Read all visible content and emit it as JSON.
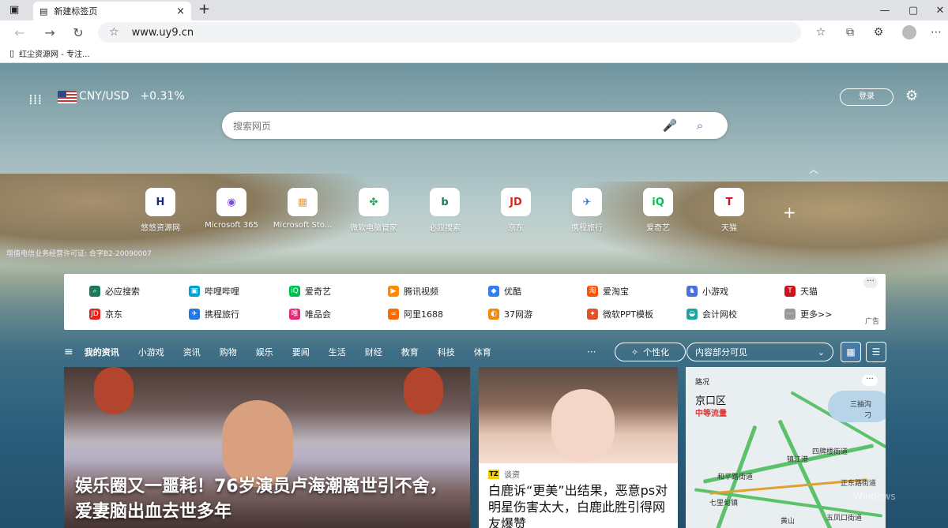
{
  "browser": {
    "tab": {
      "title": "新建标签页",
      "close": "×"
    },
    "new_tab": "+",
    "window": {
      "min": "—",
      "max": "▢",
      "close": "✕"
    },
    "address": {
      "url": "www.uy9.cn"
    },
    "bookmark": {
      "label": "红尘资源网 - 专注..."
    }
  },
  "ntp": {
    "currency": {
      "label": "CNY/USD",
      "change": "+0.31%"
    },
    "login": "登录",
    "search_placeholder": "搜索网页",
    "license": "增值电信业务经营许可证: 合字B2-20090007",
    "tiles": [
      {
        "label": "悠悠资源网",
        "glyph": "H",
        "color": "#1a2a7a"
      },
      {
        "label": "Microsoft 365",
        "glyph": "◉",
        "color": "#7a4fd6"
      },
      {
        "label": "Microsoft Sto...",
        "glyph": "▦",
        "color": "#e8a13a"
      },
      {
        "label": "微软电脑管家",
        "glyph": "✤",
        "color": "#2aa25c"
      },
      {
        "label": "必应搜索",
        "glyph": "b",
        "color": "#1b7a5a"
      },
      {
        "label": "京东",
        "glyph": "JD",
        "color": "#e1251b"
      },
      {
        "label": "携程旅行",
        "glyph": "✈",
        "color": "#2577e3"
      },
      {
        "label": "爱奇艺",
        "glyph": "iQ",
        "color": "#00c14f"
      },
      {
        "label": "天猫",
        "glyph": "T",
        "color": "#c9151e"
      }
    ],
    "links": [
      {
        "label": "必应搜索",
        "color": "#1b7a5a",
        "glyph": "⌕"
      },
      {
        "label": "哔哩哔哩",
        "color": "#00a1d6",
        "glyph": "▣"
      },
      {
        "label": "爱奇艺",
        "color": "#00c14f",
        "glyph": "iQ"
      },
      {
        "label": "腾讯视频",
        "color": "#ff8a00",
        "glyph": "▶"
      },
      {
        "label": "优酷",
        "color": "#2f7ef5",
        "glyph": "◆"
      },
      {
        "label": "爱淘宝",
        "color": "#ff5000",
        "glyph": "淘"
      },
      {
        "label": "小游戏",
        "color": "#4c6fe0",
        "glyph": "♞"
      },
      {
        "label": "天猫",
        "color": "#c9151e",
        "glyph": "T"
      },
      {
        "label": "京东",
        "color": "#e1251b",
        "glyph": "JD"
      },
      {
        "label": "携程旅行",
        "color": "#2577e3",
        "glyph": "✈"
      },
      {
        "label": "唯品会",
        "color": "#e6287b",
        "glyph": "唯"
      },
      {
        "label": "阿里1688",
        "color": "#ff6a00",
        "glyph": "∞"
      },
      {
        "label": "37网游",
        "color": "#f28a0c",
        "glyph": "◐"
      },
      {
        "label": "微软PPT模板",
        "color": "#e0532a",
        "glyph": "✦"
      },
      {
        "label": "会计网校",
        "color": "#18a6a0",
        "glyph": "◒"
      },
      {
        "label": "更多>>",
        "color": "#999999",
        "glyph": "⋯"
      }
    ],
    "ad_label": "广告",
    "more_dots": "···",
    "news_nav": [
      "我的资讯",
      "小游戏",
      "资讯",
      "购物",
      "娱乐",
      "要闻",
      "生活",
      "财经",
      "教育",
      "科技",
      "体育"
    ],
    "news_more": "···",
    "personalize": "个性化",
    "visibility": "内容部分可见",
    "cards": {
      "main_title": "娱乐圈又一噩耗！76岁演员卢海潮离世引不舍，爱妻脑出血去世多年",
      "second_source": "谈资",
      "second_badge": "TZ",
      "second_title": "白鹿诉“更美”出结果，恶意ps对明星伤害太大，白鹿此胜引得网友爆赞",
      "traffic_head": "路况",
      "traffic_title": "京口区",
      "traffic_status": "中等流量",
      "map_labels": [
        "三抽沟",
        "刁",
        "镇江港",
        "四牌楼街道",
        "和平路街道",
        "正东路街道",
        "七里甸镇",
        "黄山",
        "五凤口街道"
      ]
    },
    "watermark": "Windows"
  }
}
